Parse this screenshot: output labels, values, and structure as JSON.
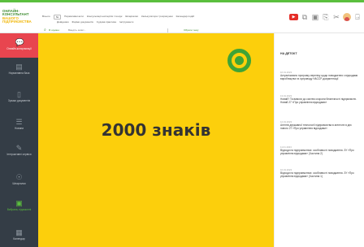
{
  "header": {
    "logo": [
      "ОНЛАЙН-",
      "КОНСУЛЬТАНТ",
      "ВАШОГО",
      "ПІДПРИЄМСТВА"
    ],
    "menu_row1": [
      "Всього",
      "№",
      "Нормативні акти",
      "Консультації експертів / пошук",
      "Шпаргалки",
      "Калькулятори / розрахунки",
      "Календар подій"
    ],
    "menu_row2": [
      "Довідники",
      "Форми документів",
      "Судова практика",
      "Інструменти"
    ],
    "search_label": "Я шукаю:",
    "search_placeholder": "Введіть запит...",
    "search_select": "Обрати тему"
  },
  "toolbar": {
    "icons": [
      "youtube-icon",
      "copy-icon",
      "save-icon",
      "export-icon",
      "scissors-icon",
      "user-avatar",
      "logout-icon"
    ]
  },
  "sidebar": {
    "items": [
      {
        "label": "Онлайн-консультації",
        "icon": "chat-icon"
      },
      {
        "label": "Нормативна база",
        "icon": "book-icon"
      },
      {
        "label": "Зразки документів",
        "icon": "document-icon"
      },
      {
        "label": "Новини",
        "icon": "news-icon"
      },
      {
        "label": "Інтерактивні сервіси",
        "icon": "pen-icon"
      },
      {
        "label": "Шпаргалки",
        "icon": "hands-icon"
      },
      {
        "label": "Вибрана, підзаконні",
        "icon": "star-icon"
      },
      {
        "label": "Календар",
        "icon": "calendar-icon"
      }
    ]
  },
  "main": {
    "headline": "2000 знаків"
  },
  "right_panel": {
    "title": "НА ДЕТОКТ",
    "news": [
      {
        "date": "16.01.2023",
        "text": "Актуалізовано програму-переліку щодо поводження з відходами виробництва та супроводу НАССР-документації"
      },
      {
        "date": "13.01.2023",
        "text": "Новий? Та вимоги до систем охорони безпечності підприємств. Новий 27 «Про управління відходами»"
      },
      {
        "date": "12.01.2023",
        "text": "Агентів державної технології підприємства в агентств в дію нового 27 «Про управління відходами»"
      },
      {
        "date": "11.01.2023",
        "text": "Відходи на підприємствах: особливості поводження. ЗУ «Про управління відходами» (Частина 2)"
      },
      {
        "date": "10.01.2023",
        "text": "Відходи на підприємствах: особливості поводження. ЗУ «Про управління відходами» (Частина 1)"
      }
    ]
  },
  "colors": {
    "accent_green": "#3ea436",
    "brand_yellow": "#fccf0c",
    "sidebar_bg": "#343d46",
    "alert_red": "#e8454f"
  }
}
